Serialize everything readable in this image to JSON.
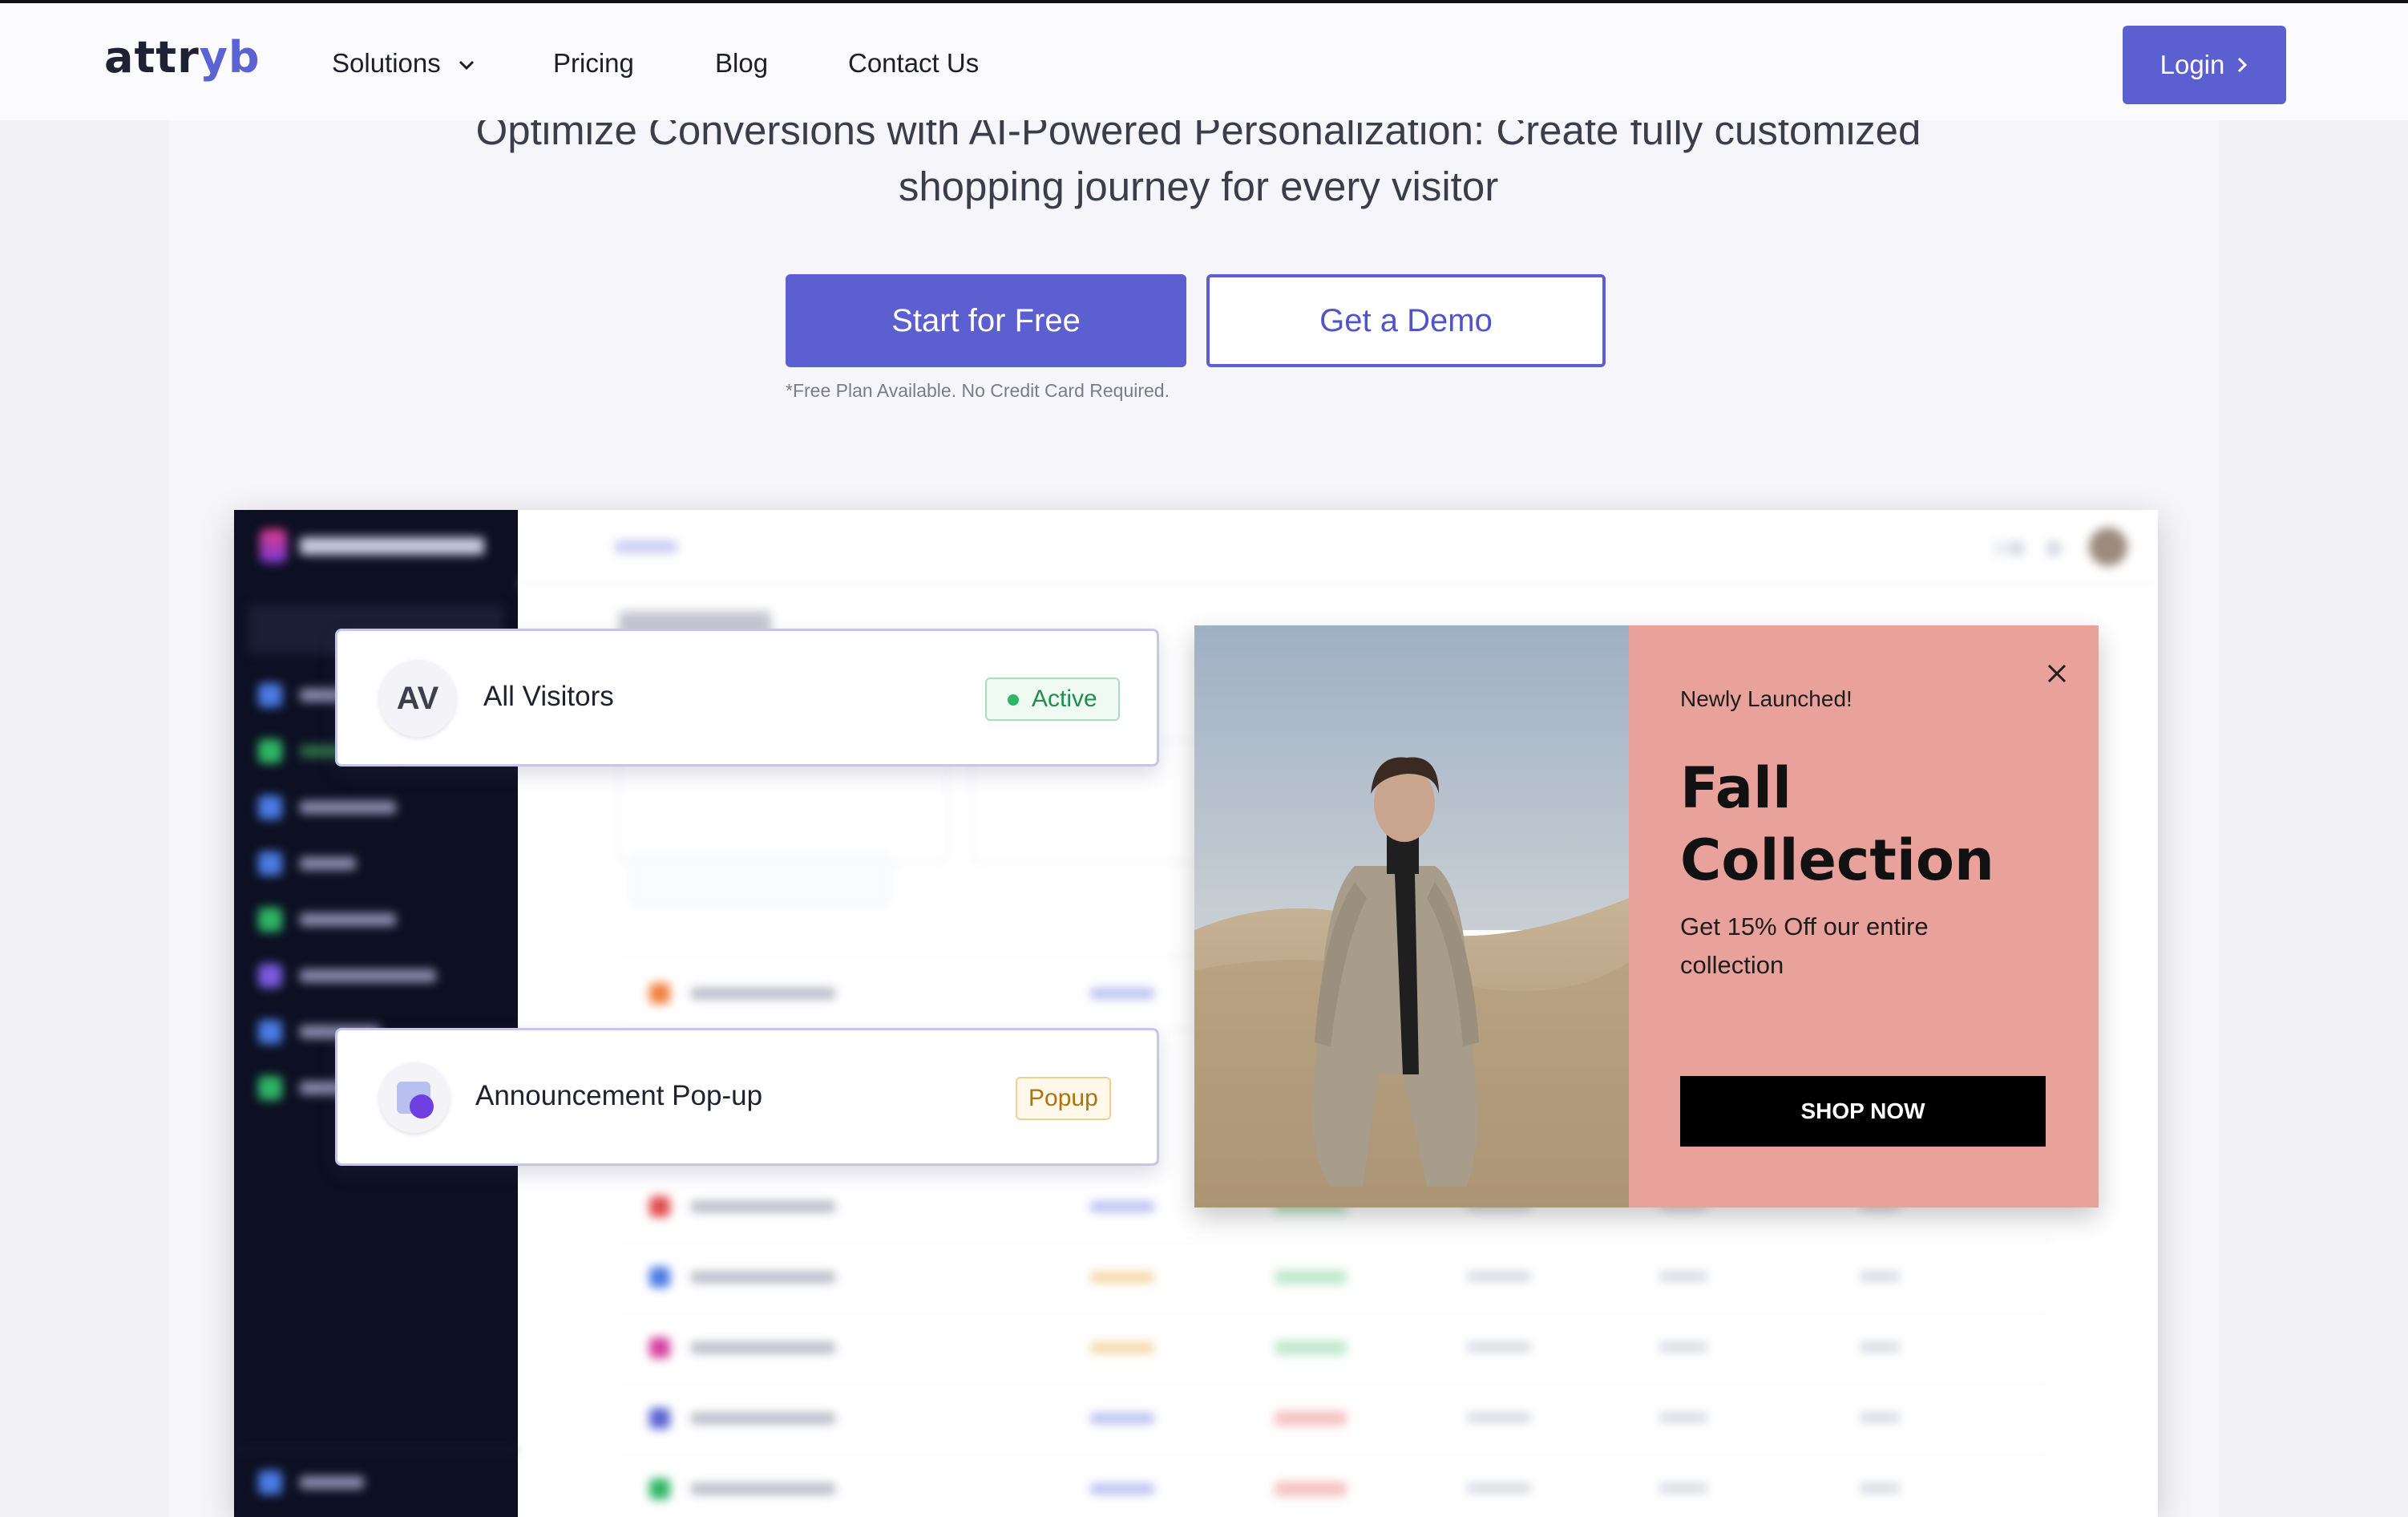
{
  "navbar": {
    "logo_prefix": "attr",
    "logo_accent": "yb",
    "items": [
      "Solutions",
      "Pricing",
      "Blog",
      "Contact Us"
    ],
    "login_label": "Login"
  },
  "hero": {
    "subtitle_line1": "Optimize Conversions with AI-Powered Personalization: Create fully customized",
    "subtitle_line2": "shopping journey for every visitor",
    "cta_primary": "Start for Free",
    "cta_secondary": "Get a Demo",
    "note": "*Free Plan Available. No Credit Card Required."
  },
  "segment_card": {
    "initials": "AV",
    "title": "All Visitors",
    "status": "Active"
  },
  "usecase_card": {
    "title": "Announcement Pop-up",
    "type": "Popup"
  },
  "promo_popup": {
    "kicker": "Newly Launched!",
    "title_line1": "Fall",
    "title_line2": "Collection",
    "subtitle": "Get 15% Off our entire collection",
    "button": "SHOP NOW"
  },
  "colors": {
    "brand": "#5b5fd0",
    "sidebar": "#0c1022",
    "promo_bg": "#e9a19c",
    "active_green": "#1e8f4c",
    "popup_amber": "#b0700f"
  },
  "icons": [
    "chevron-down-icon",
    "chevron-right-icon",
    "close-icon",
    "popup-icon"
  ]
}
